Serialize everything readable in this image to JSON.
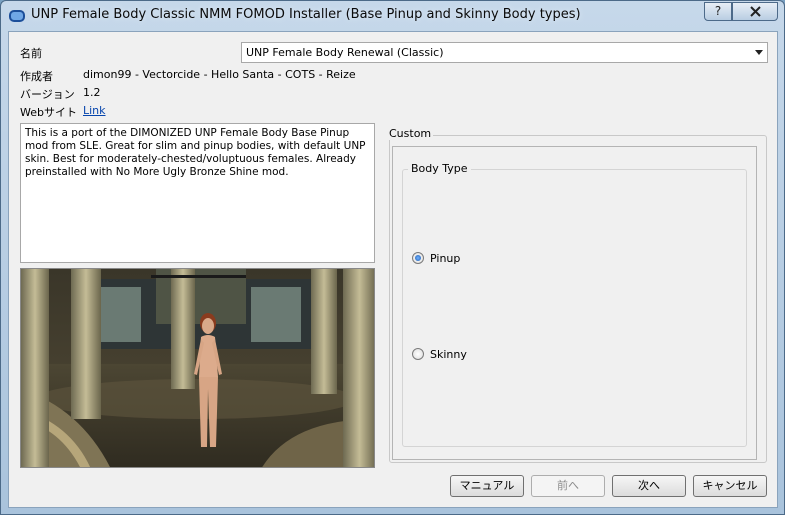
{
  "window": {
    "title": "UNP Female Body Classic NMM FOMOD Installer (Base Pinup and Skinny Body types)",
    "help_label": "?",
    "close_icon": "close-icon"
  },
  "info": {
    "name_label": "名前",
    "name_value": "UNP Female Body Renewal (Classic)",
    "author_label": "作成者",
    "author_value": "dimon99 - Vectorcide - Hello Santa - COTS - Reize",
    "version_label": "バージョン",
    "version_value": "1.2",
    "website_label": "Webサイト",
    "website_link": "Link"
  },
  "description": "This is a port of the DIMONIZED UNP Female Body Base Pinup mod from SLE. Great for slim and pinup bodies, with default UNP skin. Best for moderately-chested/voluptuous females. Already preinstalled with No More Ugly Bronze Shine mod.",
  "custom": {
    "group_label": "Custom",
    "body_type_label": "Body Type",
    "options": [
      {
        "label": "Pinup",
        "selected": true
      },
      {
        "label": "Skinny",
        "selected": false
      }
    ]
  },
  "buttons": {
    "manual": "マニュアル",
    "prev": "前へ",
    "next": "次へ",
    "cancel": "キャンセル"
  }
}
